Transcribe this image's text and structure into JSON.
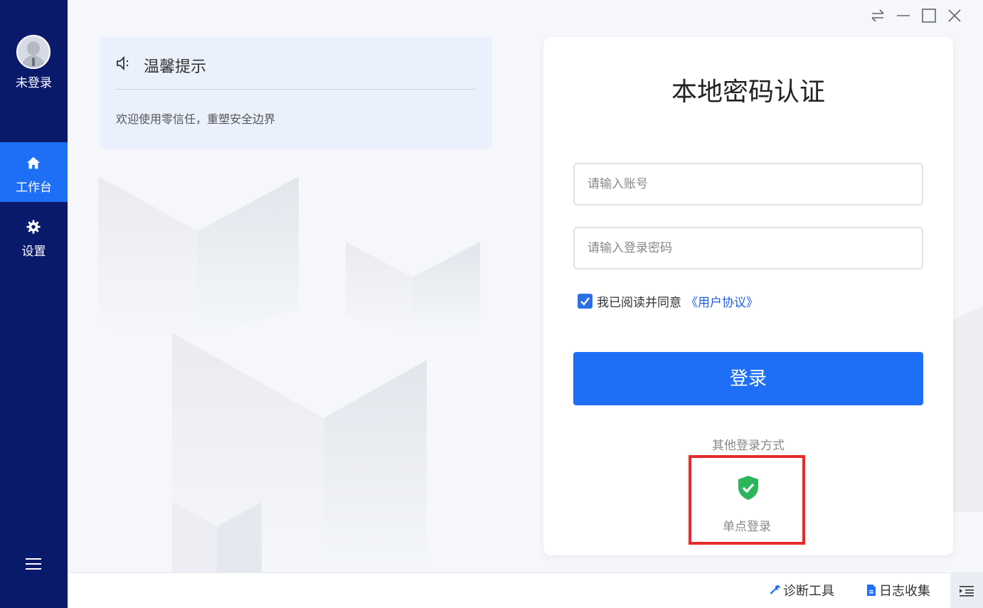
{
  "sidebar": {
    "user_label": "未登录",
    "items": [
      {
        "label": "工作台",
        "icon": "home-icon"
      },
      {
        "label": "设置",
        "icon": "gear-icon"
      }
    ],
    "menu_icon": "hamburger-menu-icon"
  },
  "window_controls": [
    "swap-icon",
    "minimize-icon",
    "maximize-icon",
    "close-icon"
  ],
  "notice": {
    "icon": "speaker-icon",
    "title": "温馨提示",
    "text": "欢迎使用零信任，重塑安全边界"
  },
  "login": {
    "title": "本地密码认证",
    "account_placeholder": "请输入账号",
    "password_placeholder": "请输入登录密码",
    "agree_text": "我已阅读并同意",
    "agree_link": "《用户协议》",
    "agree_checked": true,
    "submit_label": "登录",
    "other_methods_label": "其他登录方式",
    "sso_label": "单点登录",
    "sso_icon": "shield-check-icon"
  },
  "bottom_bar": {
    "diagnose_label": "诊断工具",
    "log_label": "日志收集"
  },
  "colors": {
    "sidebar_bg": "#0a1a6b",
    "accent": "#1e6ff6",
    "link": "#1f5fd6",
    "sso_green": "#2db55d",
    "highlight_red": "#e62b2b"
  }
}
